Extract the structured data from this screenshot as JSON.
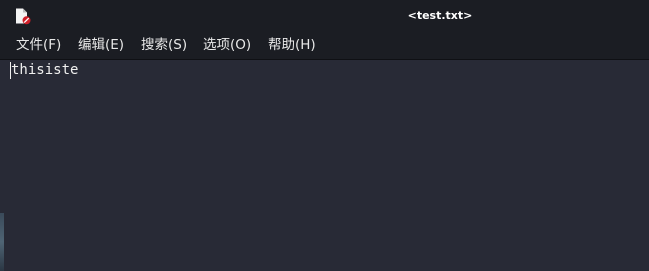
{
  "window": {
    "title": "<test.txt>",
    "icon": "text-file-icon"
  },
  "menu": {
    "items": [
      {
        "label": "文件(F)"
      },
      {
        "label": "编辑(E)"
      },
      {
        "label": "搜索(S)"
      },
      {
        "label": "选项(O)"
      },
      {
        "label": "帮助(H)"
      }
    ]
  },
  "editor": {
    "content": "thisiste"
  },
  "colors": {
    "titlebar_bg": "#1b1d23",
    "editor_bg": "#282a36",
    "text": "#f0f0f0",
    "icon_badge": "#d0202a"
  }
}
